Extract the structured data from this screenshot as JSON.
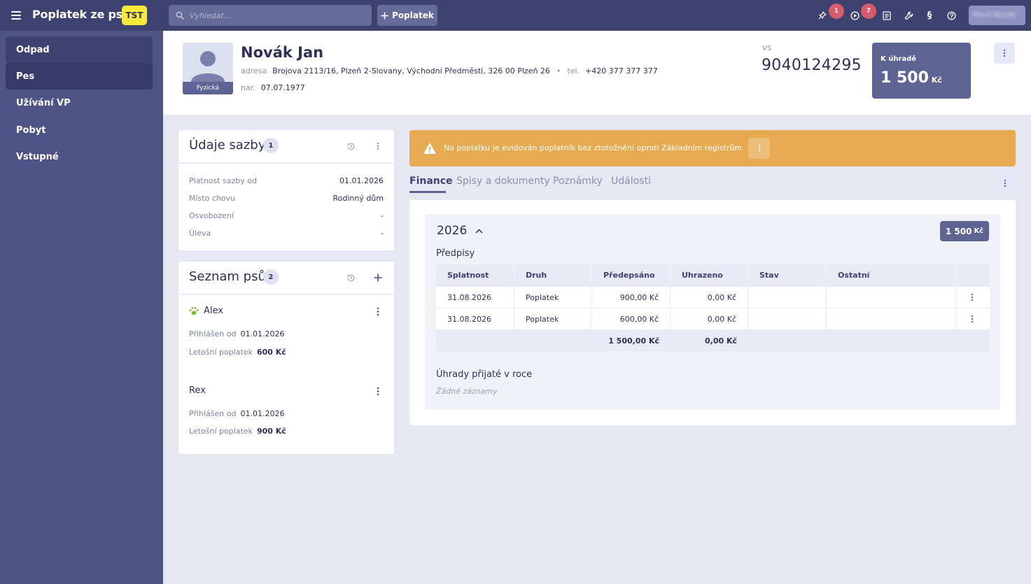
{
  "app": {
    "title": "Poplatek ze psů",
    "env_badge": "TST",
    "search_placeholder": "Vyhledat...",
    "add_button": "Poplatek",
    "notifications": {
      "pin_count": "1",
      "play_count": "7"
    },
    "user_name": "Pavel Novák"
  },
  "sidebar": {
    "items": [
      {
        "label": "Odpad"
      },
      {
        "label": "Pes"
      },
      {
        "label": "Užívání VP"
      },
      {
        "label": "Pobyt"
      },
      {
        "label": "Vstupné"
      }
    ]
  },
  "person": {
    "name": "Novák Jan",
    "type": "Fyzická",
    "address_label": "adresa",
    "address": "Brojova 2113/16, Plzeň 2-Slovany, Východní Předměstí, 326 00 Plzeň 26",
    "phone_label": "tel.",
    "phone": "+420 377 377 377",
    "birth_label": "nar.",
    "birth_date": "07.07.1977",
    "vs_label": "VS",
    "vs": "9040124295",
    "due_label": "K úhradě",
    "due_amount": "1 500",
    "due_currency": "Kč"
  },
  "rate_card": {
    "title": "Údaje sazby",
    "count": "1",
    "rows": [
      {
        "key": "Platnost sazby od",
        "value": "01.01.2026"
      },
      {
        "key": "Místo chovu",
        "value": "Rodinný dům"
      },
      {
        "key": "Osvobození",
        "value": "-"
      },
      {
        "key": "Úleva",
        "value": "-"
      }
    ]
  },
  "dogs_card": {
    "title": "Seznam psů",
    "count": "2",
    "registered_label": "Přihlášen od",
    "fee_label": "Letošní poplatek",
    "dogs": [
      {
        "name": "Alex",
        "registered": "01.01.2026",
        "fee": "600 Kč"
      },
      {
        "name": "Rex",
        "registered": "01.01.2026",
        "fee": "900 Kč"
      }
    ]
  },
  "alert": {
    "text": "Na poplatku je evidován poplatník bez ztotožnění oproti Základním registrům"
  },
  "tabs": [
    {
      "label": "Finance"
    },
    {
      "label": "Spisy a dokumenty"
    },
    {
      "label": "Poznámky"
    },
    {
      "label": "Události"
    }
  ],
  "finance": {
    "year": "2026",
    "year_amount": "1 500",
    "year_currency": "Kč",
    "prescriptions_title": "Předpisy",
    "columns": [
      "Splatnost",
      "Druh",
      "Předepsáno",
      "Uhrazeno",
      "Stav",
      "Ostatní"
    ],
    "rows": [
      {
        "due": "31.08.2026",
        "kind": "Poplatek",
        "prescribed": "900,00 Kč",
        "paid": "0,00 Kč",
        "status": "",
        "other": ""
      },
      {
        "due": "31.08.2026",
        "kind": "Poplatek",
        "prescribed": "600,00 Kč",
        "paid": "0,00 Kč",
        "status": "",
        "other": ""
      }
    ],
    "totals": {
      "prescribed": "1 500,00 Kč",
      "paid": "0,00 Kč"
    },
    "payments_title": "Úhrady přijaté v roce",
    "payments_empty": "Žádné záznamy"
  },
  "colors": {
    "topbar": "#3d4271",
    "sidebar": "#4f5487",
    "accent": "#5d6393",
    "badge_yellow": "#f7ea3b",
    "alert": "#e6ab50",
    "notification": "#d95a6d",
    "paw_green": "#7ab82c"
  }
}
